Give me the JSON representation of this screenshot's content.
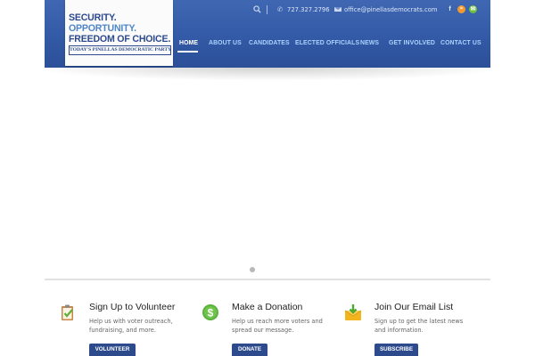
{
  "logo": {
    "line1": "SECURITY.",
    "line2": "OPPORTUNITY.",
    "line3": "FREEDOM OF CHOICE.",
    "tagline": "TODAY'S PINELLAS DEMOCRATIC PARTY"
  },
  "topbar": {
    "phone": "727.327.2796",
    "email": "office@pinellasdemocrats.com",
    "social": [
      "f",
      "rss",
      "email"
    ]
  },
  "nav": {
    "items": [
      {
        "label": "HOME",
        "active": true
      },
      {
        "label": "ABOUT US"
      },
      {
        "label": "CANDIDATES"
      },
      {
        "label": "ELECTED OFFICIALS"
      },
      {
        "label": "NEWS"
      },
      {
        "label": "GET INVOLVED"
      },
      {
        "label": "CONTACT US"
      }
    ]
  },
  "features": [
    {
      "icon": "clipboard-check-icon",
      "title": "Sign Up to Volunteer",
      "description": "Help us with voter outreach, fundraising, and more.",
      "button": "VOLUNTEER"
    },
    {
      "icon": "dollar-coin-icon",
      "title": "Make a Donation",
      "description": "Help us reach more voters and spread our message.",
      "button": "DONATE"
    },
    {
      "icon": "envelope-download-icon",
      "title": "Join Our Email List",
      "description": "Sign up to get the latest news and information.",
      "button": "SUBSCRIBE"
    }
  ],
  "colors": {
    "header": "#335aa6",
    "nav_link": "#a9d3ff",
    "button": "#2c4a8c"
  }
}
